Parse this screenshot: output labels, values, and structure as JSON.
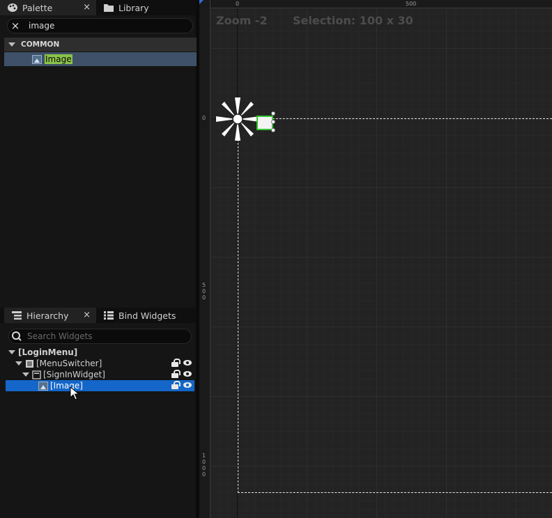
{
  "palette": {
    "tabs": [
      {
        "label": "Palette",
        "close": "×"
      },
      {
        "label": "Library"
      }
    ],
    "search": {
      "value": "image",
      "clear_icon": "×"
    },
    "category": "COMMON",
    "items": [
      {
        "label": "Image",
        "icon": "image-widget-icon"
      }
    ]
  },
  "hierarchy": {
    "tabs": [
      {
        "label": "Hierarchy",
        "close": "×"
      },
      {
        "label": "Bind Widgets"
      }
    ],
    "search": {
      "placeholder": "Search Widgets"
    },
    "rows": [
      {
        "label": "[LoginMenu]"
      },
      {
        "label": "[MenuSwitcher]"
      },
      {
        "label": "[SignInWidget]"
      },
      {
        "label": "[Image]",
        "selected": true
      }
    ]
  },
  "canvas": {
    "zoom_text": "Zoom -2",
    "selection_text": "Selection: 100 x 30",
    "ruler_top": [
      "0",
      "500"
    ],
    "ruler_left": [
      "0",
      "5\n0\n0",
      "1\n0\n0\n0"
    ]
  },
  "colors": {
    "selection": "#1466c9",
    "highlight": "#8bc34a",
    "selected_widget_border": "#33c633"
  }
}
